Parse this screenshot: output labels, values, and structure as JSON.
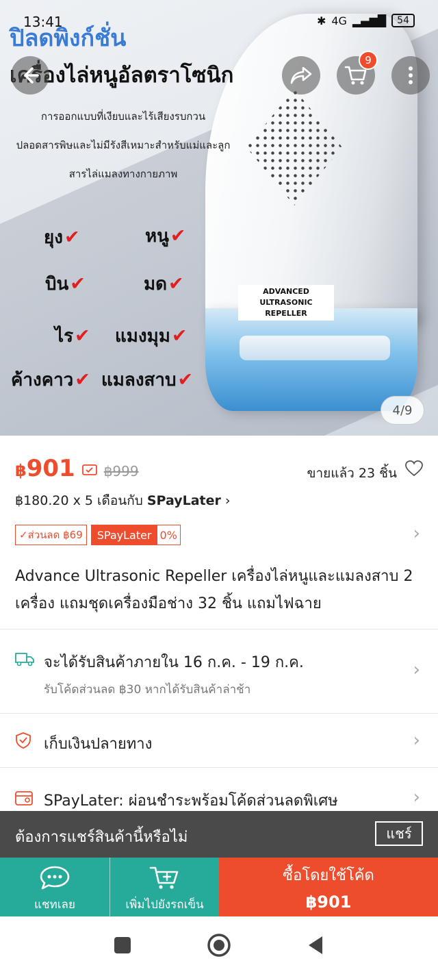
{
  "status_bar": {
    "time": "13:41",
    "network": "4G",
    "battery": "54"
  },
  "hero": {
    "headline_1": "ปิลดพิงก์ชั่น",
    "headline_2": "เครื่องไล่หนูอัลตราโซนิก",
    "line_1": "การออกแบบที่เงียบและไร้เสียงรบกวน",
    "line_2": "ปลอดสารพิษและไม่มีรังสีเหมาะสำหรับแม่และลูก",
    "line_3": "สารไล่แมลงทางกายภาพ",
    "pests": [
      "ยุง",
      "หนู",
      "บิน",
      "มด",
      "ไร",
      "แมงมุม",
      "ค้างคาว",
      "แมลงสาบ"
    ],
    "tick": "✔",
    "device_label_1": "ADVANCED",
    "device_label_2": "ULTRASONIC REPELLER",
    "counter": "4/9"
  },
  "top_buttons": {
    "cart_count": "9"
  },
  "price": {
    "currency": "฿",
    "amount": "901",
    "original": "฿999",
    "sold": "ขายแล้ว 23 ชิ้น",
    "installment_prefix": "฿180.20 x 5 เดือนกับ ",
    "installment_brand": "SPayLater",
    "installment_arrow": "›"
  },
  "promo": {
    "discount": "✓ส่วนลด ฿69",
    "spaylater": "SPayLater",
    "percent": "0%"
  },
  "chevron": "›",
  "product_title": "Advance Ultrasonic Repeller เครื่องไล่หนูและแมลงสาบ 2 เครื่อง แถมชุดเครื่องมือช่าง 32 ชิ้น แถมไฟฉาย",
  "shipping": {
    "main": "จะได้รับสินค้าภายใน 16 ก.ค. - 19 ก.ค.",
    "sub": "รับโค้ดส่วนลด ฿30 หากได้รับสินค้าล่าช้า"
  },
  "cod": {
    "label": "เก็บเงินปลายทาง"
  },
  "spaylater_row": {
    "label": "SPayLater: ผ่อนชำระพร้อมโค้ดส่วนลดพิเศษ"
  },
  "share_toast": {
    "message": "ต้องการแชร์สินค้านี้หรือไม่",
    "button": "แชร์"
  },
  "action_bar": {
    "chat": "แชทเลย",
    "add_to_cart": "เพิ่มไปยังรถเข็น",
    "buy_line1": "ซื้อโดยใช้โค้ด",
    "buy_line2": "฿901"
  },
  "colors": {
    "brand": "#ee4d2d",
    "teal": "#26aa99",
    "toast": "#4a4a4a"
  }
}
